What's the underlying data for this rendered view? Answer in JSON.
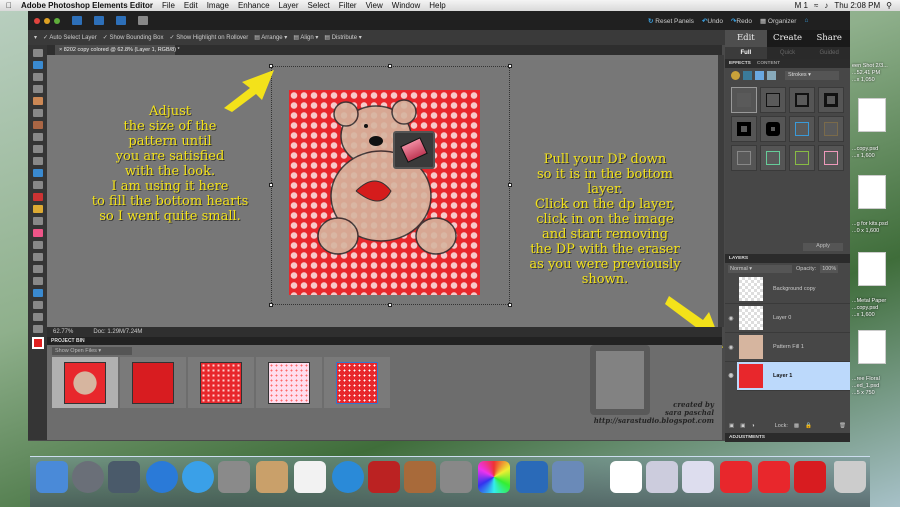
{
  "menubar": {
    "app": "Adobe Photoshop Elements Editor",
    "items": [
      "File",
      "Edit",
      "Image",
      "Enhance",
      "Layer",
      "Select",
      "Filter",
      "View",
      "Window",
      "Help"
    ],
    "clock": "Thu 2:08 PM",
    "status_icons": [
      "M 1",
      "wifi-icon",
      "volume-icon",
      "search-icon"
    ]
  },
  "topbar": {
    "reset": "Reset Panels",
    "undo": "Undo",
    "redo": "Redo",
    "organizer": "Organizer"
  },
  "options": {
    "auto_select": "Auto Select Layer",
    "bounding": "Show Bounding Box",
    "highlight": "Show Highlight on Rollover",
    "arrange": "Arrange",
    "align": "Align",
    "distribute": "Distribute"
  },
  "document": {
    "tab": "8202 copy colored @ 62.8% (Layer 1, RGB/8) *",
    "zoom": "62.77%",
    "doc": "Doc: 1.29M/7.24M"
  },
  "notes": {
    "left": "Adjust\nthe size of the\npattern  until\nyou are satisfied\nwith the look.\nI am using it here\nto fill the bottom hearts\nso I went quite small.",
    "right": "Pull your DP down\nso it is in the bottom\nlayer.\nClick on the dp layer,\nclick in on the image\nand start removing\nthe DP with the eraser\nas you were previously\nshown."
  },
  "project_bin": {
    "title": "PROJECT BIN",
    "select": "Show Open Files"
  },
  "signature": {
    "line1": "created by",
    "line2": "sara paschal",
    "line3": "http://sarastudio.blogspot.com"
  },
  "panel": {
    "tabs": [
      "Edit",
      "Create",
      "Share"
    ],
    "subtabs": [
      "Full",
      "Quick",
      "Guided"
    ],
    "effects_tabs": [
      "EFFECTS",
      "CONTENT"
    ],
    "category": "Strokes",
    "apply": "Apply",
    "layers_title": "LAYERS",
    "blend": "Normal",
    "opacity_label": "Opacity:",
    "opacity": "100%",
    "layers": [
      "Background copy",
      "Layer 0",
      "Pattern Fill 1",
      "Layer 1"
    ],
    "lock": "Lock:",
    "adjustments": "ADJUSTMENTS"
  },
  "desktop": [
    "een Shot 2/3...",
    "...52.41 PM",
    "...x 1,050",
    "...copy.psd",
    "...x 1,600",
    "...g for kits.psd",
    "...0 x 1,600",
    "...Metal Paper",
    "...copy.psd",
    "...x 1,600",
    "...ree Floral",
    "...ed_1.psd",
    "...5 x 750"
  ],
  "colors": {
    "accent": "#f3e21a",
    "canvas": "#e8272c",
    "selected_layer": "#bcd9fb"
  }
}
